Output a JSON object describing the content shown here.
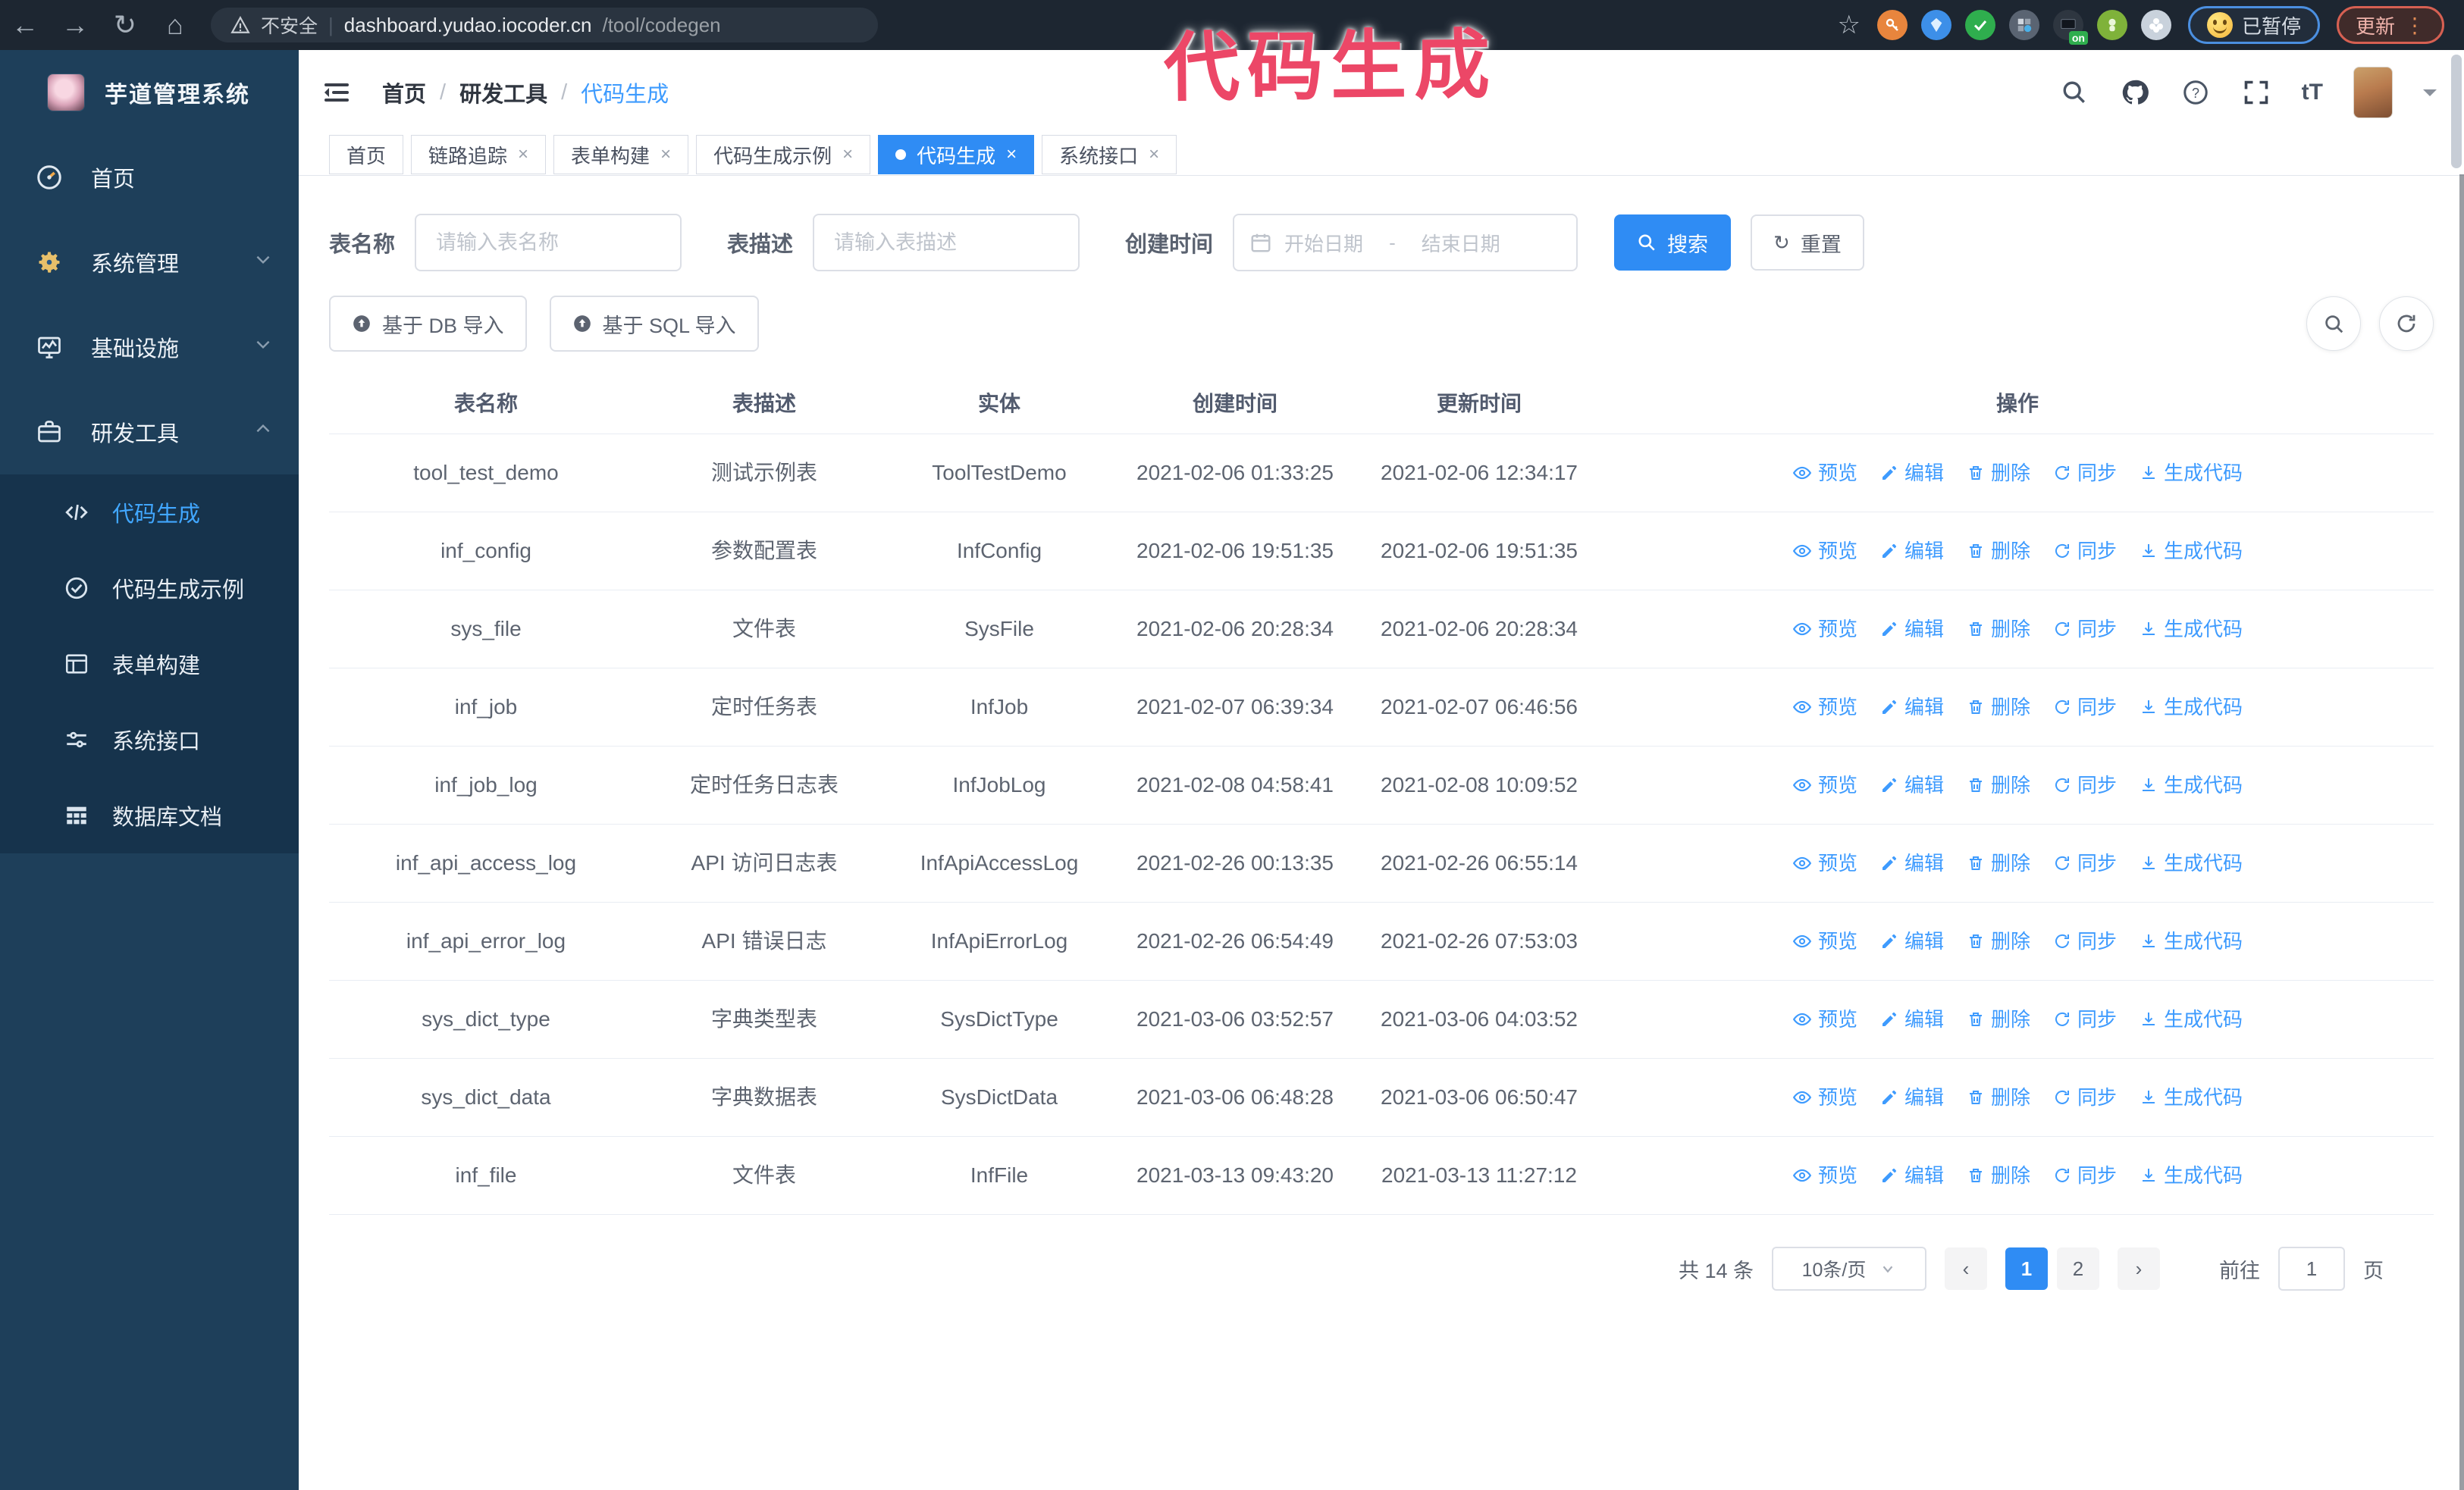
{
  "browser": {
    "security_label": "不安全",
    "url_host": "dashboard.yudao.iocoder.cn",
    "url_path": "/tool/codegen",
    "paused_badge": "已暂停",
    "update_badge": "更新",
    "extensions": [
      {
        "icon": "key-extension-icon",
        "bg": "#e8853d"
      },
      {
        "icon": "gem-extension-icon",
        "bg": "#3d8fe8"
      },
      {
        "icon": "check-shield-extension-icon",
        "bg": "#2fae4e"
      },
      {
        "icon": "grid-extension-icon",
        "bg": "#5a6472"
      },
      {
        "icon": "screen-on-extension-icon",
        "bg": "#2e3640"
      },
      {
        "icon": "alien-extension-icon",
        "bg": "#7fb23a"
      },
      {
        "icon": "puzzle-extension-icon",
        "bg": "#c9d2dc"
      }
    ]
  },
  "annotation": {
    "text": "代码生成",
    "color": "#ec4767"
  },
  "sidebar": {
    "app_title": "芋道管理系统",
    "items": [
      {
        "label": "首页",
        "icon": "dashboard-icon",
        "chevron": ""
      },
      {
        "label": "系统管理",
        "icon": "gear-icon",
        "chevron": "down"
      },
      {
        "label": "基础设施",
        "icon": "monitor-icon",
        "chevron": "down"
      },
      {
        "label": "研发工具",
        "icon": "briefcase-icon",
        "chevron": "up"
      }
    ],
    "submenu": [
      {
        "label": "代码生成",
        "icon": "code-icon",
        "active": true
      },
      {
        "label": "代码生成示例",
        "icon": "example-icon",
        "active": false
      },
      {
        "label": "表单构建",
        "icon": "form-icon",
        "active": false
      },
      {
        "label": "系统接口",
        "icon": "api-icon",
        "active": false
      },
      {
        "label": "数据库文档",
        "icon": "database-doc-icon",
        "active": false
      }
    ]
  },
  "header": {
    "breadcrumb": [
      "首页",
      "研发工具",
      "代码生成"
    ]
  },
  "tabs": [
    {
      "label": "首页",
      "closable": false,
      "active": false
    },
    {
      "label": "链路追踪",
      "closable": true,
      "active": false
    },
    {
      "label": "表单构建",
      "closable": true,
      "active": false
    },
    {
      "label": "代码生成示例",
      "closable": true,
      "active": false
    },
    {
      "label": "代码生成",
      "closable": true,
      "active": true
    },
    {
      "label": "系统接口",
      "closable": true,
      "active": false
    }
  ],
  "search_form": {
    "table_name_label": "表名称",
    "table_name_placeholder": "请输入表名称",
    "table_desc_label": "表描述",
    "table_desc_placeholder": "请输入表描述",
    "create_time_label": "创建时间",
    "start_date_placeholder": "开始日期",
    "range_separator": "-",
    "end_date_placeholder": "结束日期",
    "search_button": "搜索",
    "reset_button": "重置"
  },
  "toolbar": {
    "import_db_button": "基于 DB 导入",
    "import_sql_button": "基于 SQL 导入"
  },
  "table": {
    "columns": [
      "表名称",
      "表描述",
      "实体",
      "创建时间",
      "更新时间",
      "操作"
    ],
    "actions": [
      {
        "label": "预览",
        "icon": "eye-icon"
      },
      {
        "label": "编辑",
        "icon": "edit-icon"
      },
      {
        "label": "删除",
        "icon": "trash-icon"
      },
      {
        "label": "同步",
        "icon": "sync-icon"
      },
      {
        "label": "生成代码",
        "icon": "download-icon"
      }
    ],
    "rows": [
      {
        "name": "tool_test_demo",
        "desc": "测试示例表",
        "entity": "ToolTestDemo",
        "created": "2021-02-06 01:33:25",
        "updated": "2021-02-06 12:34:17",
        "created_wrapped": false,
        "updated_wrapped": false
      },
      {
        "name": "inf_config",
        "desc": "参数配置表",
        "entity": "InfConfig",
        "created": "2021-02-06 19:51:35",
        "updated": "2021-02-06 19:51:35",
        "created_wrapped": false,
        "updated_wrapped": false
      },
      {
        "name": "sys_file",
        "desc": "文件表",
        "entity": "SysFile",
        "created": "2021-02-06 20:28:34",
        "updated": "2021-02-06 20:28:34",
        "created_wrapped": true,
        "updated_wrapped": true
      },
      {
        "name": "inf_job",
        "desc": "定时任务表",
        "entity": "InfJob",
        "created": "2021-02-07 06:39:34",
        "updated": "2021-02-07 06:46:56",
        "created_wrapped": true,
        "updated_wrapped": true
      },
      {
        "name": "inf_job_log",
        "desc": "定时任务日志表",
        "entity": "InfJobLog",
        "created": "2021-02-08 04:58:41",
        "updated": "2021-02-08 10:09:52",
        "created_wrapped": true,
        "updated_wrapped": true
      },
      {
        "name": "inf_api_access_log",
        "desc": "API 访问日志表",
        "entity": "InfApiAccessLog",
        "created": "2021-02-26 00:13:35",
        "updated": "2021-02-26 06:55:14",
        "created_wrapped": false,
        "updated_wrapped": true
      },
      {
        "name": "inf_api_error_log",
        "desc": "API 错误日志",
        "entity": "InfApiErrorLog",
        "created": "2021-02-26 06:54:49",
        "updated": "2021-02-26 07:53:03",
        "created_wrapped": true,
        "updated_wrapped": true
      },
      {
        "name": "sys_dict_type",
        "desc": "字典类型表",
        "entity": "SysDictType",
        "created": "2021-03-06 03:52:57",
        "updated": "2021-03-06 04:03:52",
        "created_wrapped": true,
        "updated_wrapped": true
      },
      {
        "name": "sys_dict_data",
        "desc": "字典数据表",
        "entity": "SysDictData",
        "created": "2021-03-06 06:48:28",
        "updated": "2021-03-06 06:50:47",
        "created_wrapped": true,
        "updated_wrapped": true
      },
      {
        "name": "inf_file",
        "desc": "文件表",
        "entity": "InfFile",
        "created": "2021-03-13 09:43:20",
        "updated": "2021-03-13 11:27:12",
        "created_wrapped": true,
        "updated_wrapped": false
      }
    ]
  },
  "pagination": {
    "total_text": "共 14 条",
    "page_size": "10条/页",
    "pages": [
      "1",
      "2"
    ],
    "active_page": "1",
    "goto_label": "前往",
    "goto_value": "1",
    "goto_suffix": "页"
  },
  "colors": {
    "accent": "#2f8cf4",
    "sidebar_bg": "#1e3f5a",
    "submenu_bg": "#16334c",
    "annotation_pink": "#ec4767"
  }
}
